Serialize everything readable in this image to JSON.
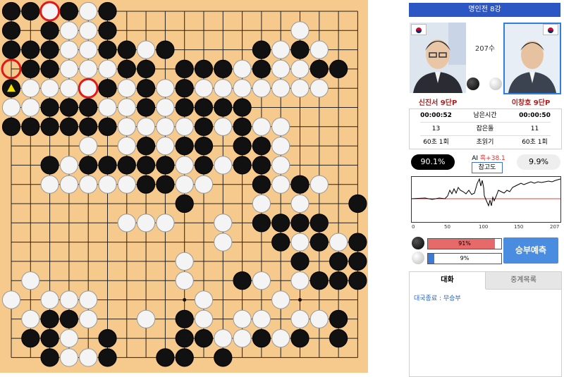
{
  "board": {
    "size": 19,
    "stones": [
      "BBWBWB.............",
      "B.BWWB.........W...",
      "BBBWWBBWB....BWBW..",
      ".BBWWWBB.BBBWBWWBB.",
      "BWWWWBWBWBWWWWWWW..",
      "WWBBBWWBWBBBB......",
      "BBBBBBWWWWBWBWW....",
      "....W.WBWBB.BBW....",
      "..BWBBBBBWBWBBW....",
      "..WWWWWBBWW..BWBW..",
      ".........B...W.W..B",
      "......WWW..W.BBBB..",
      "...........W..BWBWB",
      ".........W.....B.BB",
      ".W.......W..BW.WBBB",
      "W.WWW.....W...W....",
      ".WBBW..W.BW.WW.WWB.",
      ".BBW.B...BBWWBWB.B.",
      "..BWWB..BB.B.......",
      "..BWWW..B.WBBB.BB..",
      "..BW.W............."
    ],
    "last_move_marker": "yellow-triangle",
    "last_move": [
      0,
      4
    ],
    "circle_marks": [
      [
        2,
        0
      ],
      [
        0,
        3
      ],
      [
        4,
        4
      ]
    ]
  },
  "side": {
    "title": "명인전 8강",
    "move_label": "207수",
    "black_player": "신진서 9단P",
    "white_player": "이창호 9단P",
    "info": {
      "black_time": "00:00:52",
      "time_label": "남은시간",
      "white_time": "00:00:50",
      "black_captures": "13",
      "captures_label": "잡은돌",
      "white_captures": "11",
      "black_byoyomi": "60초 1회",
      "byoyomi_label": "초읽기",
      "white_byoyomi": "60초 1회"
    },
    "ai": {
      "black_pct": "90.1%",
      "white_pct": "9.9%",
      "ai_label": "AI",
      "ai_value": "흑+38.1",
      "ref_button": "참고도",
      "black_win": 91,
      "white_win": 9,
      "black_bar_label": "91%",
      "white_bar_label": "9%",
      "predict_button": "승부예측"
    },
    "graph": {
      "x_ticks": [
        "0",
        "50",
        "100",
        "150",
        "207"
      ]
    },
    "tabs": {
      "chat": "대화",
      "record": "중계목록"
    },
    "chat_message": "대국종료 : 무승부",
    "colors": {
      "title_blue": "#2b56c4",
      "bar_red": "#e76a6a",
      "bar_blue": "#3b7bd6",
      "predict_blue": "#4a8de0",
      "board_wood": "#f6c98d"
    }
  }
}
